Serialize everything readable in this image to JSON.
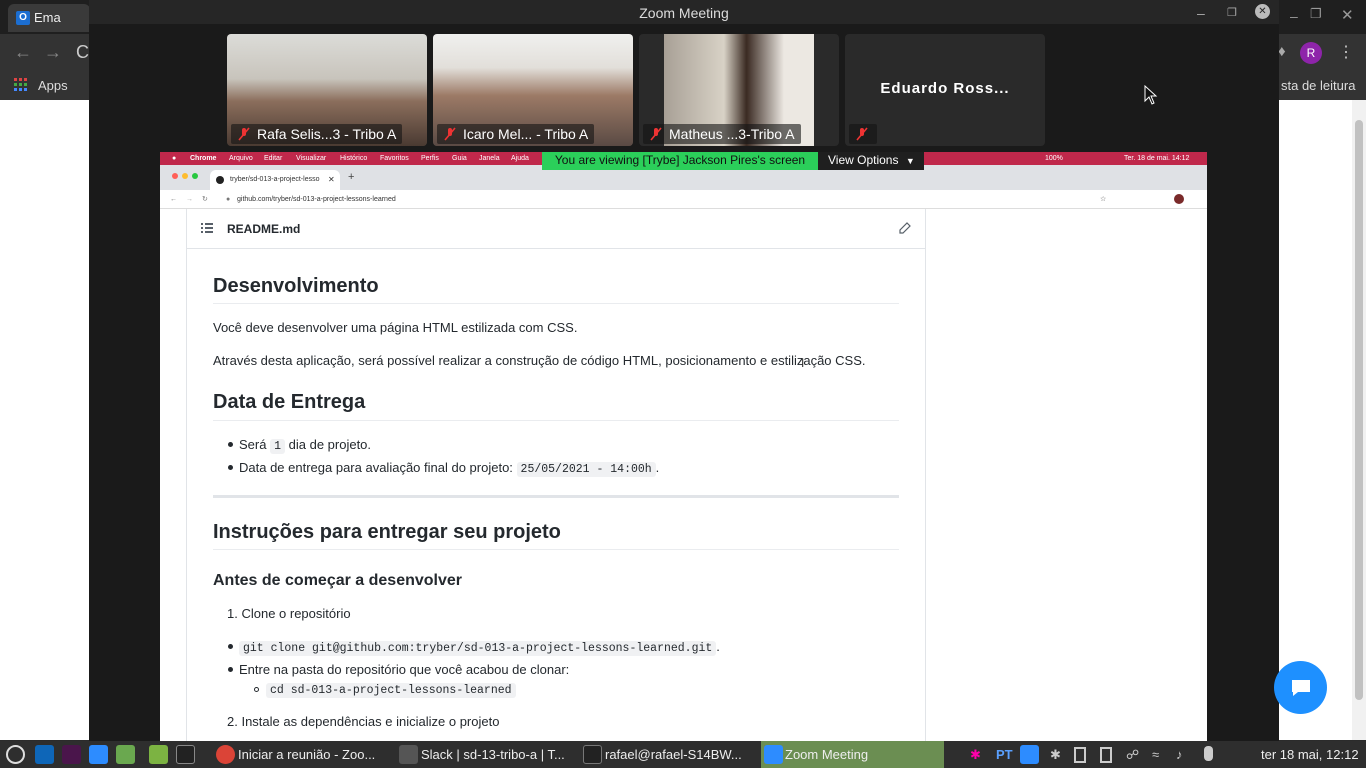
{
  "background_browser": {
    "tab_label": "Ema",
    "bookmarks_apps": "Apps",
    "reading_list": "sta de leitura",
    "profile_initial": "R"
  },
  "zoom": {
    "title": "Zoom Meeting",
    "participants": [
      {
        "name": "Rafa Selis...3 - Tribo A"
      },
      {
        "name": "Icaro Mel... - Tribo A"
      },
      {
        "name": "Matheus ...3-Tribo A"
      },
      {
        "name": "Eduardo  Ross..."
      }
    ],
    "viewing_banner": "You are viewing [Trybe] Jackson Pires's screen",
    "view_options": "View Options"
  },
  "shared_screen": {
    "mac_menu": [
      "Chrome",
      "Arquivo",
      "Editar",
      "Visualizar",
      "Histórico",
      "Favoritos",
      "Perfis",
      "Guia",
      "Janela",
      "Ajuda"
    ],
    "mac_clock": "Ter. 18 de mai.  14:12",
    "mac_battery": "100%",
    "tab_title": "tryber/sd-013-a-project-lesso",
    "address": "github.com/tryber/sd-013-a-project-lessons-learned",
    "readme": {
      "filename": "README.md",
      "h_dev": "Desenvolvimento",
      "p1": "Você deve desenvolver uma página HTML estilizada com CSS.",
      "p2": "Através desta aplicação, será possível realizar a construção de código HTML, posicionamento e estilização CSS.",
      "h_data": "Data de Entrega",
      "li1_a": "Será",
      "li1_code": "1",
      "li1_b": "dia de projeto.",
      "li2_a": "Data de entrega para avaliação final do projeto:",
      "li2_code": "25/05/2021 - 14:00h",
      "li2_b": ".",
      "h_instr": "Instruções para entregar seu projeto",
      "h_antes": "Antes de começar a desenvolver",
      "ol1": "1. Clone o repositório",
      "git_code": "git clone git@github.com:tryber/sd-013-a-project-lessons-learned.git",
      "git_dot": ".",
      "entre": "Entre na pasta do repositório que você acabou de clonar:",
      "cd_code": "cd sd-013-a-project-lessons-learned",
      "ol2": "2. Instale as dependências e inicialize o projeto"
    }
  },
  "taskbar": {
    "items": [
      "Iniciar a reunião - Zoo...",
      "Slack | sd-13-tribo-a | T...",
      "rafael@rafael-S14BW...",
      "Zoom Meeting"
    ],
    "lang": "PT",
    "clock": "ter 18 mai, 12:12"
  },
  "colors": {
    "zoom_banner": "#2bcf5a",
    "mac_menubar": "#c0284b",
    "chat_button": "#1e90ff"
  }
}
